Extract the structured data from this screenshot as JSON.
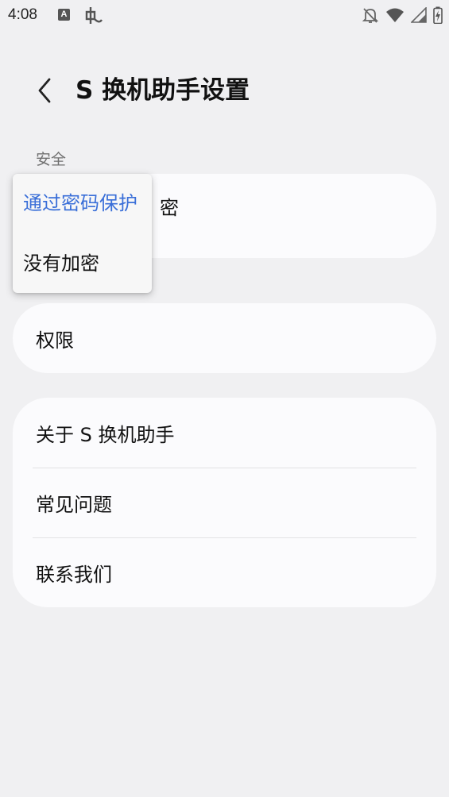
{
  "status_bar": {
    "time": "4:08",
    "a_badge": "A",
    "icons": [
      "a-notification-icon",
      "bug-icon",
      "mute-bell-icon",
      "wifi-icon",
      "signal-icon",
      "battery-charging-icon"
    ]
  },
  "header": {
    "back_icon": "chevron-left-icon",
    "title": "S 换机助手设置"
  },
  "security": {
    "section_label": "安全",
    "encryption_row_visible_fragment": "密"
  },
  "section2": {
    "label_partially_hidden": ""
  },
  "permissions": {
    "label": "权限"
  },
  "info_card": {
    "items": [
      {
        "label": "关于 S 换机助手"
      },
      {
        "label": "常见问题"
      },
      {
        "label": "联系我们"
      }
    ]
  },
  "encryption_popup": {
    "options": [
      {
        "label": "通过密码保护",
        "selected": true
      },
      {
        "label": "没有加密",
        "selected": false
      }
    ],
    "selected_color": "#3a6fd8"
  },
  "colors": {
    "background": "#f0f0f2",
    "card": "#fbfbfd",
    "accent": "#3a6fd8"
  }
}
